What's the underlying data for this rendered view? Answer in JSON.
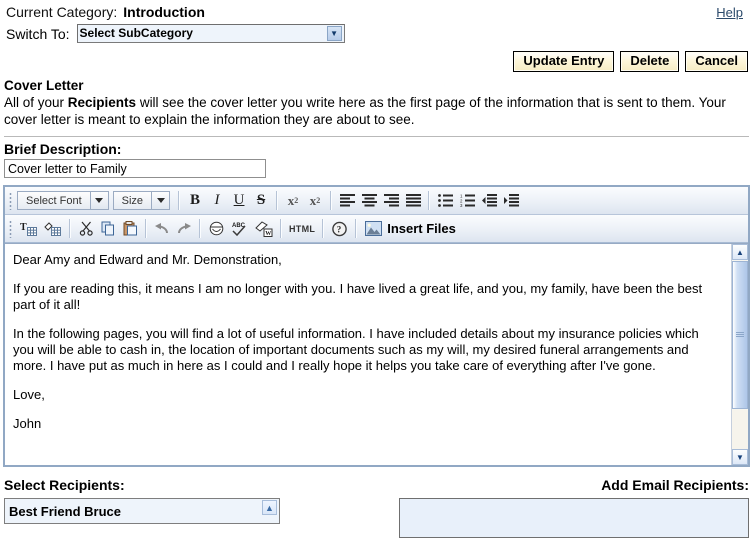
{
  "header": {
    "current_category_label": "Current Category:",
    "current_category_value": "Introduction",
    "help_link": "Help",
    "switch_to_label": "Switch To:",
    "subcategory_selected": "Select SubCategory"
  },
  "actions": {
    "update": "Update Entry",
    "delete": "Delete",
    "cancel": "Cancel"
  },
  "cover_letter": {
    "title": "Cover Letter",
    "desc_part1": "All of your ",
    "desc_bold": "Recipients",
    "desc_part2": " will see the cover letter you write here as the first page of the information that is sent to them. Your cover letter is meant to explain the information they are about to see."
  },
  "brief": {
    "label": "Brief Description:",
    "value": "Cover letter to Family",
    "placeholder": ""
  },
  "toolbar": {
    "font_label": "Select Font",
    "size_label": "Size",
    "bold": "B",
    "italic": "I",
    "underline": "U",
    "strike": "S",
    "subscript": "x",
    "superscript": "x",
    "html_label": "HTML",
    "insert_files_label": "Insert Files"
  },
  "editor": {
    "paragraphs": [
      "Dear Amy and Edward and Mr. Demonstration,",
      "If you are reading this, it means I am no longer with you. I have lived a great life, and you, my family, have been the best part of it all!",
      "In the following pages, you will find a lot of useful information. I have included details about my insurance policies which you will be able to cash in, the location of important documents such as my will, my desired funeral arrangements and more. I have put as much in here as I could and I really hope it helps you take care of everything after I've gone.",
      "Love,",
      "John"
    ]
  },
  "recipients": {
    "select_label": "Select Recipients:",
    "selected_recipient": "Best Friend Bruce",
    "add_email_label": "Add Email Recipients:",
    "email_value": "",
    "email_placeholder": ""
  },
  "colors": {
    "accent_border": "#91a8c4",
    "button_bg": "#fdf6da",
    "field_bg": "#eef4fb",
    "link": "#2b4a6b"
  }
}
